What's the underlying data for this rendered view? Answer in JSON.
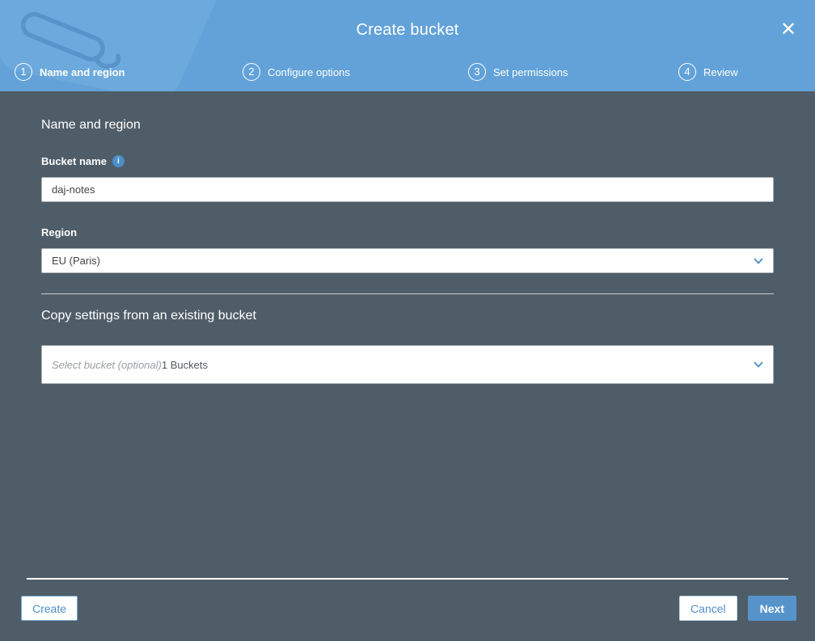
{
  "window": {
    "title": "Create bucket",
    "close_glyph": "✕"
  },
  "steps": [
    {
      "number": "1",
      "label": "Name and region",
      "active": true
    },
    {
      "number": "2",
      "label": "Configure options",
      "active": false
    },
    {
      "number": "3",
      "label": "Set permissions",
      "active": false
    },
    {
      "number": "4",
      "label": "Review",
      "active": false
    }
  ],
  "form": {
    "section_heading": "Name and region",
    "bucket_name": {
      "label": "Bucket name",
      "value": "daj-notes",
      "info_glyph": "i"
    },
    "region": {
      "label": "Region",
      "value": "EU (Paris)"
    },
    "copy_settings": {
      "heading": "Copy settings from an existing bucket",
      "placeholder": "Select bucket (optional)",
      "count_text": "1 Buckets"
    }
  },
  "footer": {
    "create": "Create",
    "cancel": "Cancel",
    "next": "Next"
  },
  "colors": {
    "header_blue": "#62A2D8",
    "body_slate": "#4F5D68",
    "accent_blue": "#5793CB",
    "link_blue": "#4D8FC8",
    "info_blue": "#4A90CB"
  }
}
